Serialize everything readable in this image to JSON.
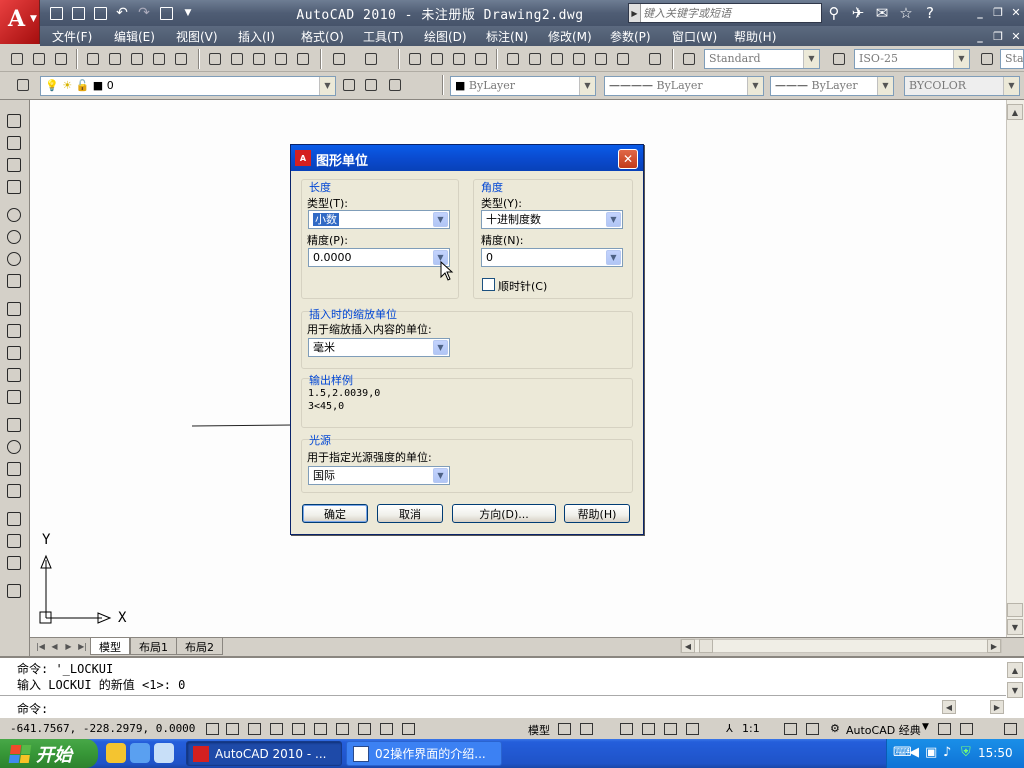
{
  "window": {
    "title": "AutoCAD 2010 - 未注册版   Drawing2.dwg",
    "search_placeholder": "键入关键字或短语"
  },
  "menu": {
    "items": [
      "文件(F)",
      "编辑(E)",
      "视图(V)",
      "插入(I)",
      "格式(O)",
      "工具(T)",
      "绘图(D)",
      "标注(N)",
      "修改(M)",
      "参数(P)",
      "窗口(W)",
      "帮助(H)"
    ]
  },
  "toolbar": {
    "text_style": "Standard",
    "dim_style": "ISO-25",
    "table_style": "Sta",
    "layer_value": "0",
    "color": "ByLayer",
    "linetype": "ByLayer",
    "lineweight": "ByLayer",
    "plot_style": "BYCOLOR"
  },
  "drawing": {
    "ucs_x": "X",
    "ucs_y": "Y"
  },
  "tabs": [
    "模型",
    "布局1",
    "布局2"
  ],
  "command": {
    "history": [
      "命令: '_LOCKUI",
      "输入 LOCKUI 的新值 <1>: 0"
    ],
    "prompt": "命令:"
  },
  "status": {
    "coords": "-641.7567, -228.2979, 0.0000",
    "model": "模型",
    "scale": "1:1",
    "workspace": "AutoCAD 经典"
  },
  "taskbar": {
    "start": "开始",
    "tasks": [
      "AutoCAD 2010 - ...",
      "02操作界面的介绍..."
    ],
    "clock": "15:50"
  },
  "dialog": {
    "title": "图形单位",
    "length": {
      "group": "长度",
      "type_label": "类型(T):",
      "type_value": "小数",
      "precision_label": "精度(P):",
      "precision_value": "0.0000"
    },
    "angle": {
      "group": "角度",
      "type_label": "类型(Y):",
      "type_value": "十进制度数",
      "precision_label": "精度(N):",
      "precision_value": "0",
      "clockwise_label": "顺时针(C)",
      "clockwise_checked": false
    },
    "insertion": {
      "group": "插入时的缩放单位",
      "label": "用于缩放插入内容的单位:",
      "value": "毫米"
    },
    "sample": {
      "group": "输出样例",
      "line1": "1.5,2.0039,0",
      "line2": "3<45,0"
    },
    "lighting": {
      "group": "光源",
      "label": "用于指定光源强度的单位:",
      "value": "国际"
    },
    "buttons": {
      "ok": "确定",
      "cancel": "取消",
      "direction": "方向(D)...",
      "help": "帮助(H)"
    }
  },
  "colors": {
    "accent": "#0a5ce8",
    "group_label": "#0046d5"
  }
}
